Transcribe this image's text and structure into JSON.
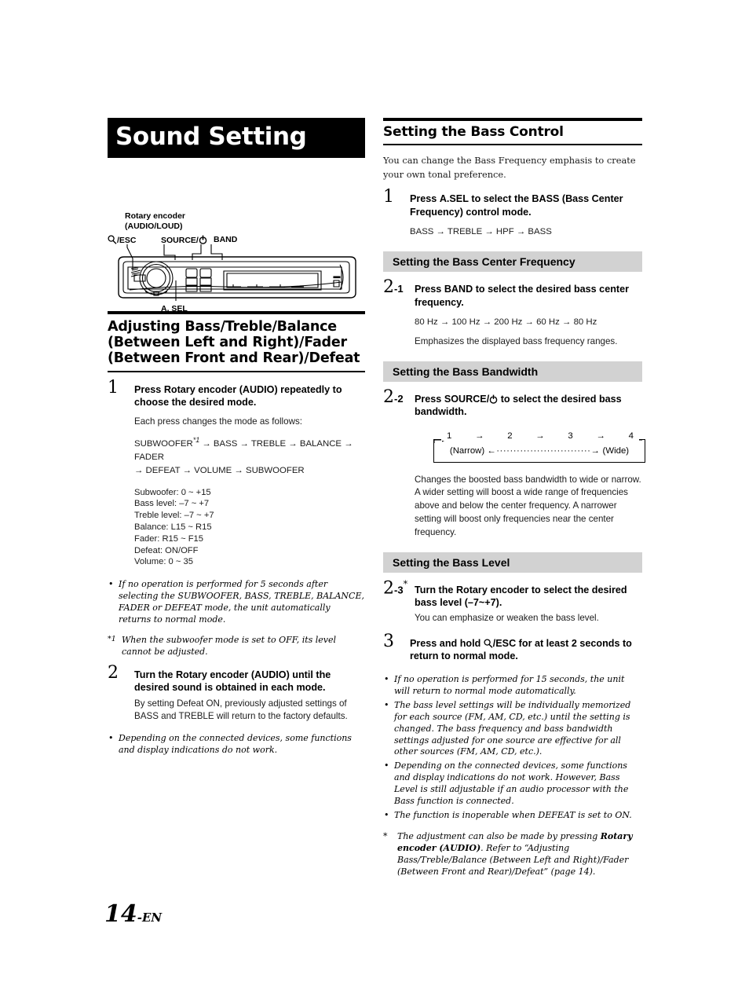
{
  "chapter": {
    "title": "Sound Setting"
  },
  "device_diagram": {
    "callouts": {
      "rotary_encoder": "Rotary encoder\n(AUDIO/LOUD)",
      "rotary_encoder_line1": "Rotary encoder",
      "rotary_encoder_line2": "(AUDIO/LOUD)",
      "esc": "/ESC",
      "esc_icon": "magnifier-icon",
      "source": "SOURCE/",
      "source_icon": "power-icon",
      "band": "BAND",
      "a_sel": "A. SEL"
    }
  },
  "left_column": {
    "heading": "Adjusting Bass/Treble/Balance (Between Left and Right)/Fader (Between Front and Rear)/Defeat",
    "step1": {
      "number": "1",
      "title_pre": "Press ",
      "title_bold": "Rotary encoder (AUDIO)",
      "title_post": " repeatedly to choose the desired mode.",
      "body": "Each press changes the mode as follows:",
      "flow_line1": "SUBWOOFER*1 → BASS → TREBLE → BALANCE → FADER",
      "flow_line2": "→ DEFEAT → VOLUME → SUBWOOFER",
      "flow_prefix": "SUBWOOFER",
      "flow_footnote": "*1",
      "flow_rest1": " → BASS → TREBLE → BALANCE → FADER",
      "levels": [
        "Subwoofer: 0 ~ +15",
        "Bass level: –7 ~ +7",
        "Treble level: –7 ~ +7",
        "Balance: L15 ~ R15",
        "Fader: R15 ~ F15",
        "Defeat: ON/OFF",
        "Volume: 0 ~ 35"
      ]
    },
    "note1": "If no operation is performed for 5 seconds after selecting the SUBWOOFER, BASS, TREBLE, BALANCE, FADER or DEFEAT mode, the unit automatically returns to normal mode.",
    "footnote1_marker": "*1",
    "footnote1": "When the subwoofer mode is set to OFF, its level cannot be adjusted.",
    "step2": {
      "number": "2",
      "title_pre": "Turn the ",
      "title_bold": "Rotary encoder (AUDIO)",
      "title_post": " until the desired sound is obtained in each mode.",
      "body": "By setting Defeat ON, previously adjusted settings of BASS and TREBLE will return to the factory defaults."
    },
    "note2": "Depending on the connected devices, some functions and display indications do not work."
  },
  "right_column": {
    "heading": "Setting the Bass Control",
    "intro": "You can change the Bass Frequency emphasis to create your own tonal preference.",
    "step1": {
      "number": "1",
      "title_pre": "Press ",
      "title_bold": "A.SEL",
      "title_post": " to select the BASS (Bass Center Frequency) control mode.",
      "flow": "BASS → TREBLE → HPF → BASS"
    },
    "section_center_frequency": {
      "heading": "Setting the Bass Center Frequency",
      "number": "2",
      "sub_index": "-1",
      "title_pre": "Press ",
      "title_bold": "BAND",
      "title_post": " to select the desired bass center frequency.",
      "flow": "80 Hz → 100 Hz → 200 Hz → 60 Hz → 80 Hz",
      "body": "Emphasizes the displayed bass frequency ranges."
    },
    "section_bandwidth": {
      "heading": "Setting the Bass Bandwidth",
      "number": "2",
      "sub_index": "-2",
      "title_pre": "Press ",
      "title_bold": "SOURCE/",
      "title_icon": "power-icon",
      "title_post": " to select the desired bass bandwidth.",
      "diagram": {
        "steps": [
          "1",
          "2",
          "3",
          "4"
        ],
        "arrows": [
          "→",
          "→",
          "→"
        ],
        "left_label": "(Narrow)",
        "right_label": "(Wide)"
      },
      "body": "Changes the boosted bass bandwidth to wide or narrow. A wider setting will boost a wide range of frequencies above and below the center frequency. A narrower setting will boost only frequencies near the center frequency."
    },
    "section_level": {
      "heading": "Setting the Bass Level",
      "number": "2",
      "sub_index": "-3",
      "star": "*",
      "title_pre": "Turn the ",
      "title_bold": "Rotary encoder",
      "title_post": " to select the desired bass level (–7~+7).",
      "body": "You can emphasize or weaken the bass level."
    },
    "step3": {
      "number": "3",
      "title_pre": "Press and hold ",
      "title_icon": "magnifier-icon",
      "title_bold": "/ESC",
      "title_post": " for at least 2 seconds to return to normal mode."
    },
    "notes": [
      "If no operation is performed for 15 seconds, the unit will return to normal mode automatically.",
      "The bass level settings will be individually memorized for each source (FM, AM, CD, etc.) until the setting is changed. The bass frequency and bass bandwidth settings adjusted for one source are effective for all other sources (FM, AM, CD, etc.).",
      "Depending on the connected devices, some functions and display indications do not work. However, Bass Level is still adjustable if an audio processor with the Bass function is connected.",
      "The function is inoperable when DEFEAT is set to ON."
    ],
    "footnote_marker": "*",
    "footnote_pre": "The adjustment can also be made by pressing ",
    "footnote_bold": "Rotary encoder (AUDIO)",
    "footnote_post": ". Refer to “Adjusting Bass/Treble/Balance (Between Left and Right)/Fader (Between Front and Rear)/Defeat” (page 14)."
  },
  "footer": {
    "page_number": "14",
    "suffix": "-EN"
  }
}
